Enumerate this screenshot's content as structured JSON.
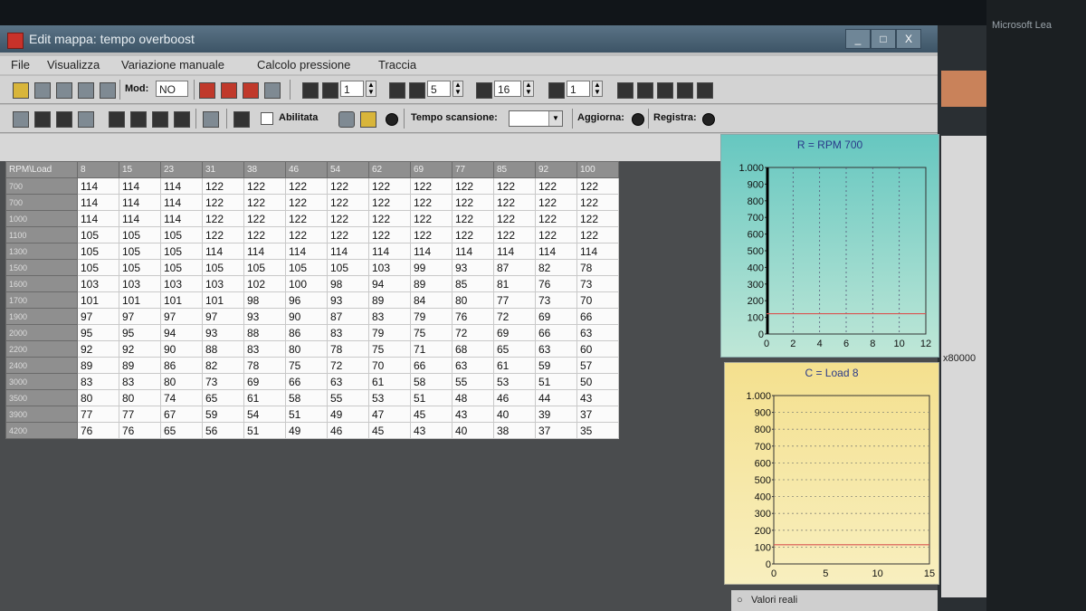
{
  "window": {
    "title": "Edit mappa: tempo overboost",
    "controls": [
      "_",
      "□",
      "X"
    ]
  },
  "menu": [
    "File",
    "Visualizza",
    "Variazione manuale",
    "Calcolo pressione",
    "Traccia"
  ],
  "toolbar1": {
    "mod_label": "Mod:",
    "mod_value": "NO",
    "spin_values": [
      "1",
      "5",
      "16",
      "1"
    ]
  },
  "toolbar2": {
    "abilitata_label": "Abilitata",
    "tempo_label": "Tempo scansione:",
    "tempo_value": "",
    "aggiorna_label": "Aggiorna:",
    "registra_label": "Registra:"
  },
  "table": {
    "corner": "RPM\\Load",
    "columns": [
      "8",
      "15",
      "23",
      "31",
      "38",
      "46",
      "54",
      "62",
      "69",
      "77",
      "85",
      "92",
      "100"
    ],
    "rows": [
      {
        "rpm": "700",
        "values": [
          "114",
          "114",
          "114",
          "122",
          "122",
          "122",
          "122",
          "122",
          "122",
          "122",
          "122",
          "122",
          "122"
        ]
      },
      {
        "rpm": "700",
        "values": [
          "114",
          "114",
          "114",
          "122",
          "122",
          "122",
          "122",
          "122",
          "122",
          "122",
          "122",
          "122",
          "122"
        ]
      },
      {
        "rpm": "1000",
        "values": [
          "114",
          "114",
          "114",
          "122",
          "122",
          "122",
          "122",
          "122",
          "122",
          "122",
          "122",
          "122",
          "122"
        ]
      },
      {
        "rpm": "1100",
        "values": [
          "105",
          "105",
          "105",
          "122",
          "122",
          "122",
          "122",
          "122",
          "122",
          "122",
          "122",
          "122",
          "122"
        ]
      },
      {
        "rpm": "1300",
        "values": [
          "105",
          "105",
          "105",
          "114",
          "114",
          "114",
          "114",
          "114",
          "114",
          "114",
          "114",
          "114",
          "114"
        ]
      },
      {
        "rpm": "1500",
        "values": [
          "105",
          "105",
          "105",
          "105",
          "105",
          "105",
          "105",
          "103",
          "99",
          "93",
          "87",
          "82",
          "78"
        ]
      },
      {
        "rpm": "1600",
        "values": [
          "103",
          "103",
          "103",
          "103",
          "102",
          "100",
          "98",
          "94",
          "89",
          "85",
          "81",
          "76",
          "73"
        ]
      },
      {
        "rpm": "1700",
        "values": [
          "101",
          "101",
          "101",
          "101",
          "98",
          "96",
          "93",
          "89",
          "84",
          "80",
          "77",
          "73",
          "70"
        ]
      },
      {
        "rpm": "1900",
        "values": [
          "97",
          "97",
          "97",
          "97",
          "93",
          "90",
          "87",
          "83",
          "79",
          "76",
          "72",
          "69",
          "66"
        ]
      },
      {
        "rpm": "2000",
        "values": [
          "95",
          "95",
          "94",
          "93",
          "88",
          "86",
          "83",
          "79",
          "75",
          "72",
          "69",
          "66",
          "63"
        ]
      },
      {
        "rpm": "2200",
        "values": [
          "92",
          "92",
          "90",
          "88",
          "83",
          "80",
          "78",
          "75",
          "71",
          "68",
          "65",
          "63",
          "60"
        ]
      },
      {
        "rpm": "2400",
        "values": [
          "89",
          "89",
          "86",
          "82",
          "78",
          "75",
          "72",
          "70",
          "66",
          "63",
          "61",
          "59",
          "57"
        ]
      },
      {
        "rpm": "3000",
        "values": [
          "83",
          "83",
          "80",
          "73",
          "69",
          "66",
          "63",
          "61",
          "58",
          "55",
          "53",
          "51",
          "50"
        ]
      },
      {
        "rpm": "3500",
        "values": [
          "80",
          "80",
          "74",
          "65",
          "61",
          "58",
          "55",
          "53",
          "51",
          "48",
          "46",
          "44",
          "43"
        ]
      },
      {
        "rpm": "3900",
        "values": [
          "77",
          "77",
          "67",
          "59",
          "54",
          "51",
          "49",
          "47",
          "45",
          "43",
          "40",
          "39",
          "37"
        ]
      },
      {
        "rpm": "4200",
        "values": [
          "76",
          "76",
          "65",
          "56",
          "51",
          "49",
          "46",
          "45",
          "43",
          "40",
          "38",
          "37",
          "35"
        ]
      }
    ]
  },
  "chart_data": [
    {
      "type": "line",
      "title": "R = RPM 700",
      "x_ticks": [
        "0",
        "2",
        "4",
        "6",
        "8",
        "10",
        "12"
      ],
      "y_ticks": [
        "0",
        "100",
        "200",
        "300",
        "400",
        "500",
        "600",
        "700",
        "800",
        "900",
        "1.000"
      ],
      "xlim": [
        0,
        12
      ],
      "ylim": [
        0,
        1000
      ],
      "grid": "vertical dashed",
      "series": [
        {
          "x": [
            0,
            12
          ],
          "y": [
            122,
            122
          ],
          "color": "#d9534f"
        }
      ],
      "marker_x": 0
    },
    {
      "type": "line",
      "title": "C = Load 8",
      "x_ticks": [
        "0",
        "5",
        "10",
        "15"
      ],
      "y_ticks": [
        "0",
        "100",
        "200",
        "300",
        "400",
        "500",
        "600",
        "700",
        "800",
        "900",
        "1.000"
      ],
      "xlim": [
        0,
        15
      ],
      "ylim": [
        0,
        1000
      ],
      "grid": "horizontal dashed",
      "series": [
        {
          "x": [
            0,
            15
          ],
          "y": [
            114,
            114
          ],
          "color": "#d9534f"
        }
      ]
    }
  ],
  "footer": {
    "label": "Valori reali"
  },
  "background": {
    "right_text": "Microsoft Lea",
    "hex_text": "x80000"
  },
  "colors": {
    "titlebar": "#4a6172",
    "table_header": "#8f8f8f",
    "chart1_bg": "#8fd7cb",
    "chart2_bg": "#f5e59b",
    "series": "#d9534f"
  }
}
